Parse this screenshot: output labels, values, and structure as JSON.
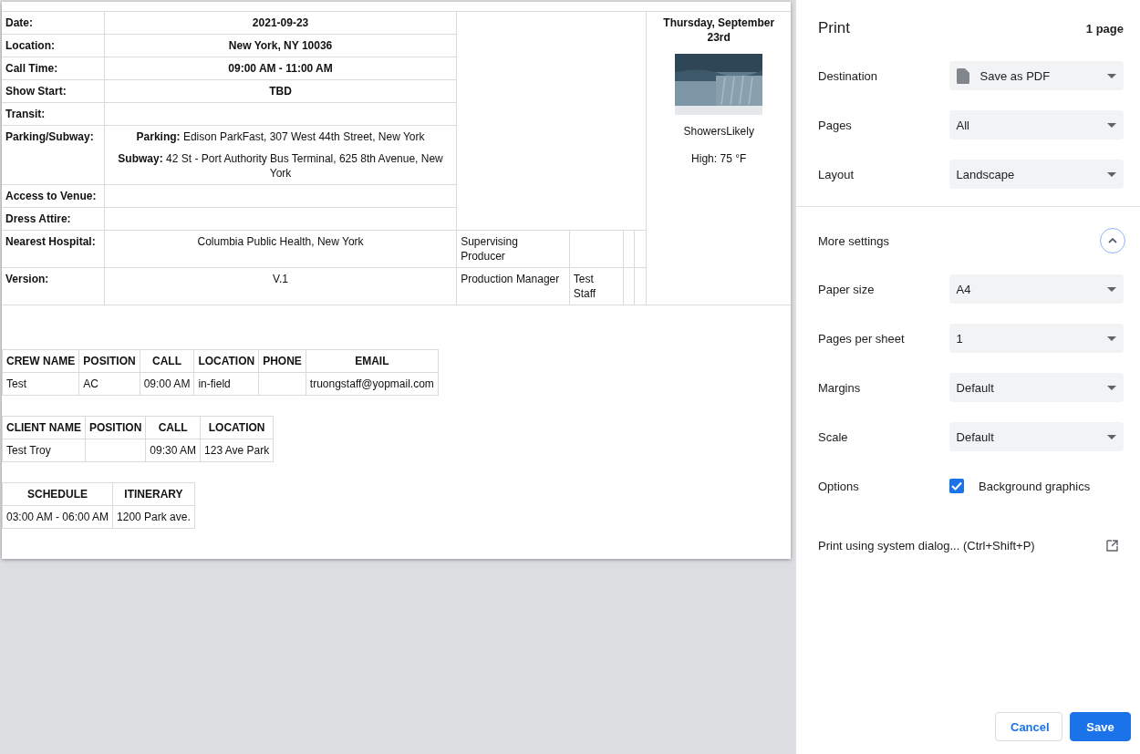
{
  "preview": {
    "info_rows": [
      {
        "label": "Date:",
        "value": [
          "2021-09-23"
        ],
        "bold": true
      },
      {
        "label": "Location:",
        "value": [
          "New York, NY 10036"
        ],
        "bold": true
      },
      {
        "label": "Call Time:",
        "value": [
          "09:00 AM - 11:00 AM"
        ],
        "bold": true
      },
      {
        "label": "Show Start:",
        "value": [
          "TBD"
        ],
        "bold": true
      },
      {
        "label": "Transit:",
        "value": []
      },
      {
        "label": "Parking/Subway:",
        "value": [
          "**Parking:** Edison ParkFast, 307 West 44th Street, New York",
          "**Subway:** 42 St - Port Authority Bus Terminal, 625 8th Avenue, New York"
        ],
        "bold": false
      },
      {
        "label": "Access to Venue:",
        "value": []
      },
      {
        "label": "Dress Attire:",
        "value": []
      },
      {
        "label": "Nearest Hospital:",
        "value": [
          "Columbia Public Health, New York"
        ],
        "bold": false,
        "role": "Supervising Producer"
      },
      {
        "label": "Version:",
        "value": [
          "V.1"
        ],
        "bold": false,
        "role": "Production Manager",
        "name": "Test Staff"
      }
    ],
    "weather": {
      "date": "Thursday, September 23rd",
      "condition": "ShowersLikely",
      "high": "High: 75 °F"
    },
    "tables": [
      {
        "columns": [
          "CREW NAME",
          "POSITION",
          "CALL",
          "LOCATION",
          "PHONE",
          "EMAIL"
        ],
        "rows": [
          [
            "Test",
            "AC",
            "09:00 AM",
            "in-field",
            null,
            "truongstaff@yopmail.com"
          ]
        ]
      },
      {
        "columns": [
          "CLIENT NAME",
          "POSITION",
          "CALL",
          "LOCATION"
        ],
        "rows": [
          [
            "Test Troy",
            null,
            "09:30 AM",
            "123 Ave Park"
          ]
        ]
      },
      {
        "columns": [
          "SCHEDULE",
          "ITINERARY"
        ],
        "rows": [
          [
            "03:00 AM - 06:00 AM",
            "1200 Park ave."
          ]
        ]
      }
    ]
  },
  "print_panel": {
    "title": "Print",
    "page_count": "1 page",
    "settings": [
      {
        "label": "Destination",
        "kind": "destination",
        "value": "Save as PDF"
      },
      {
        "label": "Pages",
        "kind": "select",
        "value": "All"
      },
      {
        "label": "Layout",
        "kind": "select",
        "value": "Landscape"
      }
    ],
    "more_settings": {
      "label": "More settings",
      "expanded": true
    },
    "more": [
      {
        "label": "Paper size",
        "kind": "select",
        "value": "A4"
      },
      {
        "label": "Pages per sheet",
        "kind": "select",
        "value": "1"
      },
      {
        "label": "Margins",
        "kind": "select",
        "value": "Default"
      },
      {
        "label": "Scale",
        "kind": "select",
        "value": "Default"
      },
      {
        "label": "Options",
        "kind": "checkbox",
        "value": "Background graphics",
        "checked": true
      }
    ],
    "system_dialog": "Print using system dialog... (Ctrl+Shift+P)",
    "buttons": [
      {
        "label": "Cancel",
        "primary": false
      },
      {
        "label": "Save",
        "primary": true
      }
    ]
  }
}
